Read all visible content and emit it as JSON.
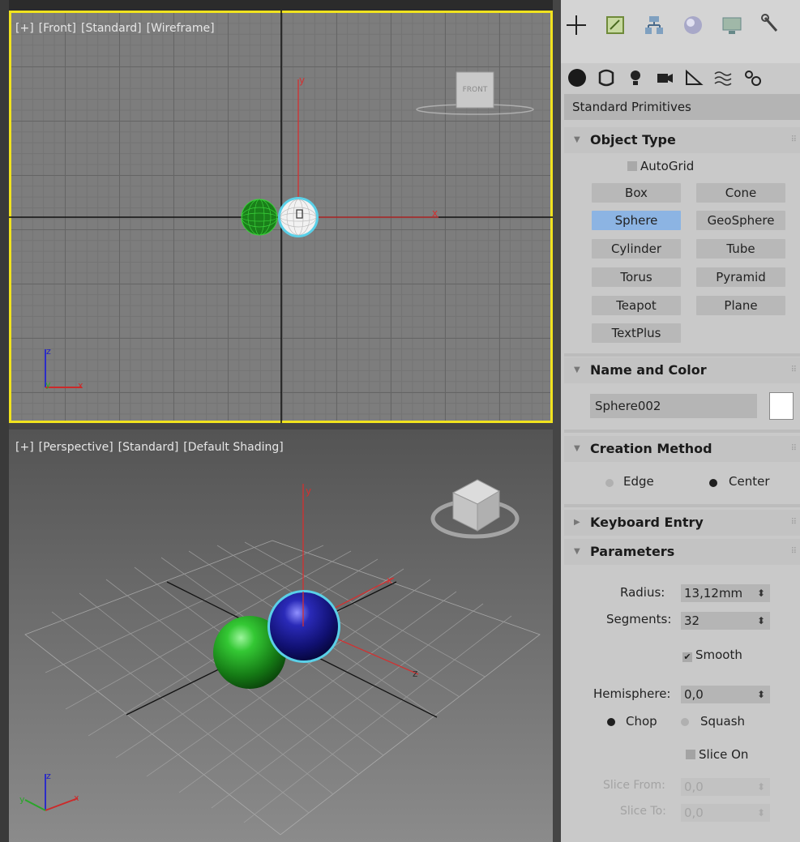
{
  "viewports": {
    "front": {
      "labels": [
        "[+]",
        "[Front]",
        "[Standard]",
        "[Wireframe]"
      ],
      "viewcube_label": "FRONT",
      "axis_labels": {
        "x": "x",
        "y": "y",
        "z": "z"
      }
    },
    "perspective": {
      "labels": [
        "[+]",
        "[Perspective]",
        "[Standard]",
        "[Default Shading]"
      ],
      "axis_labels": {
        "x": "x",
        "y": "y",
        "z": "z"
      }
    }
  },
  "panel": {
    "tabs": [
      "create-icon",
      "modify-icon",
      "hierarchy-icon",
      "motion-icon",
      "display-icon",
      "utilities-icon"
    ],
    "subtabs": [
      "geometry-icon",
      "shapes-icon",
      "lights-icon",
      "cameras-icon",
      "helpers-icon",
      "spacewarps-icon",
      "systems-icon"
    ],
    "category": "Standard Primitives",
    "object_type": {
      "title": "Object Type",
      "autogrid": "AutoGrid",
      "buttons": [
        "Box",
        "Cone",
        "Sphere",
        "GeoSphere",
        "Cylinder",
        "Tube",
        "Torus",
        "Pyramid",
        "Teapot",
        "Plane",
        "TextPlus"
      ],
      "active": "Sphere"
    },
    "name_color": {
      "title": "Name and Color",
      "name": "Sphere002",
      "color": "#ffffff"
    },
    "creation_method": {
      "title": "Creation Method",
      "edge": "Edge",
      "center": "Center",
      "selected": "Center"
    },
    "keyboard_entry": {
      "title": "Keyboard Entry"
    },
    "parameters": {
      "title": "Parameters",
      "radius_label": "Radius:",
      "radius": "13,12mm",
      "segments_label": "Segments:",
      "segments": "32",
      "smooth": "Smooth",
      "hemisphere_label": "Hemisphere:",
      "hemisphere": "0,0",
      "chop": "Chop",
      "squash": "Squash",
      "slice_on": "Slice On",
      "slice_from_label": "Slice From:",
      "slice_from": "0,0",
      "slice_to_label": "Slice To:",
      "slice_to": "0,0"
    }
  },
  "colors": {
    "active_viewport_border": "#f1e31e",
    "active_button": "#8cb4e3",
    "sphere_green": "#1f9a1f",
    "sphere_blue": "#1b1b9a",
    "selection_cyan": "#5ad0e8"
  }
}
